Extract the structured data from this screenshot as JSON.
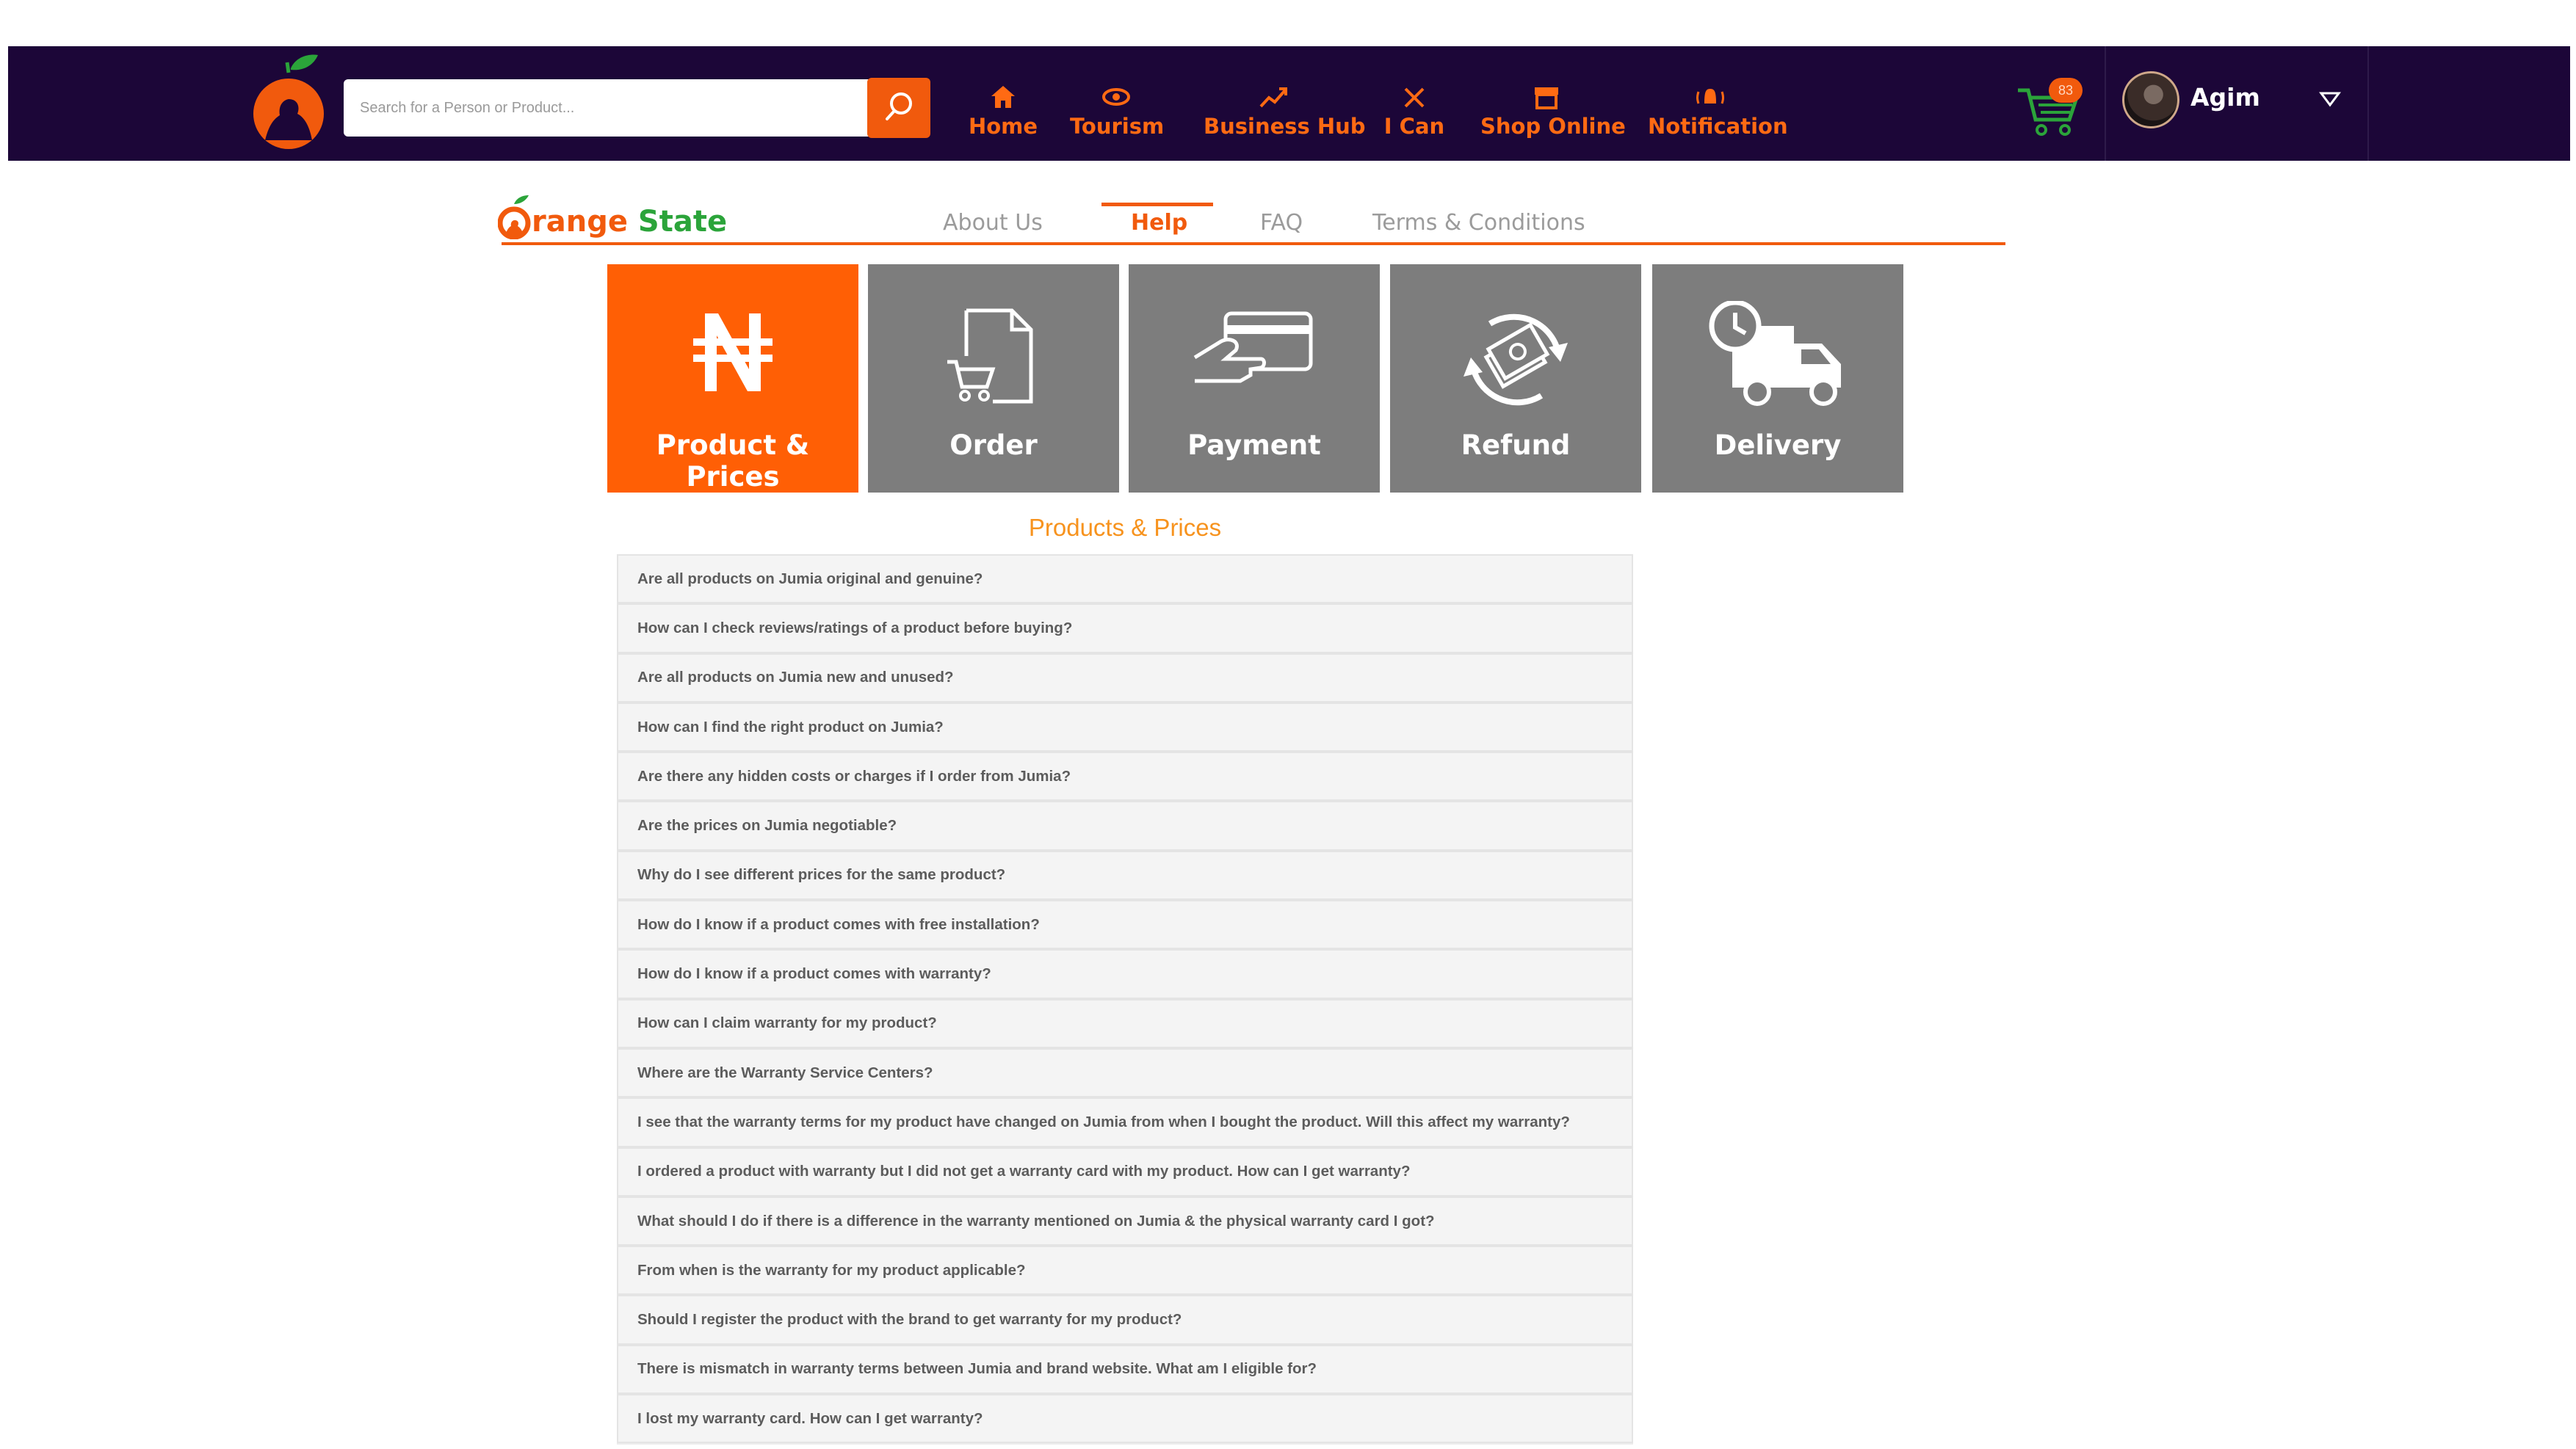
{
  "header": {
    "search_placeholder": "Search for a Person or Product...",
    "nav": [
      {
        "label": "Home",
        "icon": "home-icon"
      },
      {
        "label": "Tourism",
        "icon": "eye-icon"
      },
      {
        "label": "Business Hub",
        "icon": "chart-up-icon"
      },
      {
        "label": "I Can",
        "icon": "tools-icon"
      },
      {
        "label": "Shop Online",
        "icon": "store-icon"
      },
      {
        "label": "Notification",
        "icon": "bell-icon"
      }
    ],
    "cart_count": "83",
    "user_name": "Agim"
  },
  "brand": {
    "part1": "range",
    "part2": "State"
  },
  "subnav": [
    {
      "label": "About Us"
    },
    {
      "label": "Help"
    },
    {
      "label": "FAQ"
    },
    {
      "label": "Terms & Conditions"
    }
  ],
  "categories": [
    {
      "label": "Product & Prices",
      "icon": "naira-icon"
    },
    {
      "label": "Order",
      "icon": "order-cart-icon"
    },
    {
      "label": "Payment",
      "icon": "card-payment-icon"
    },
    {
      "label": "Refund",
      "icon": "refund-cash-icon"
    },
    {
      "label": "Delivery",
      "icon": "delivery-truck-icon"
    }
  ],
  "section_title": "Products & Prices",
  "faqs": [
    "Are all products on Jumia original and genuine?",
    "How can I check reviews/ratings of a product before buying?",
    "Are all products on Jumia new and unused?",
    "How can I find the right product on Jumia?",
    "Are there any hidden costs or charges if I order from Jumia?",
    "Are the prices on Jumia negotiable?",
    "Why do I see different prices for the same product?",
    "How do I know if a product comes with free installation?",
    "How do I know if a product comes with warranty?",
    "How can I claim warranty for my product?",
    "Where are the Warranty Service Centers?",
    "I see that the warranty terms for my product have changed on Jumia from when I bought the product. Will this affect my warranty?",
    "I ordered a product with warranty but I did not get a warranty card with my product. How can I get warranty?",
    "What should I do if there is a difference in the warranty mentioned on Jumia & the physical warranty card I got?",
    "From when is the warranty for my product applicable?",
    "Should I register the product with the brand to get warranty for my product?",
    "There is mismatch in warranty terms between Jumia and brand website. What am I eligible for?",
    "I lost my warranty card. How can I get warranty?"
  ],
  "colors": {
    "nav_bg": "#1c0638",
    "accent": "#f15a0d",
    "brand_green": "#2ba43a",
    "tile_gray": "#7d7d7d",
    "section_title": "#f7931e"
  }
}
